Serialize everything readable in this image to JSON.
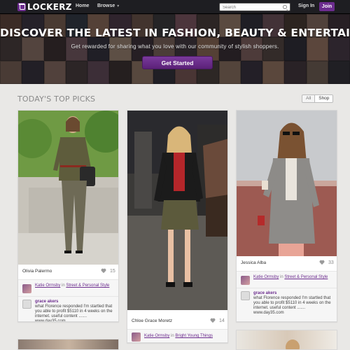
{
  "nav": {
    "logo": "LOCKERZ",
    "home": "Home",
    "browse": "Browse",
    "search_placeholder": "Search",
    "sign_in": "Sign In",
    "join": "Join"
  },
  "hero": {
    "title": "DISCOVER THE LATEST IN FASHION, BEAUTY & ENTERTAINMENT",
    "subtitle": "Get rewarded for sharing what you love with our community of stylish shoppers.",
    "cta": "Get Started"
  },
  "section": {
    "title": "TODAY'S TOP PICKS",
    "filter_all": "All",
    "filter_shop": "Shop"
  },
  "pins": [
    {
      "name": "Olivia Palermo",
      "likes": "15",
      "user": "Katie Ormsby",
      "in_word": "in",
      "board": "Street & Personal Style",
      "commenter": "grace akers",
      "comment": "what Florence responded I'm startled that you able to profit $5110 in 4 weeks on the internet. useful content ....... www.day35.com"
    },
    {
      "name": "Chloe Grace Moretz",
      "likes": "14",
      "user": "Katie Ormsby",
      "in_word": "in",
      "board": "Bright Young Things"
    },
    {
      "name": "Jessica Alba",
      "likes": "33",
      "user": "Katie Ormsby",
      "in_word": "in",
      "board": "Street & Personal Style",
      "commenter": "grace akers",
      "comment": "what Florence responded I'm startled that you able to profit $5110 in 4 weeks on the internet. useful content ....... www.day35.com"
    }
  ],
  "colors": {
    "brand": "#6c2c8e",
    "topbar": "#1e1e22",
    "page_bg": "#e9e8e6"
  },
  "icons": [
    "search-icon",
    "heart-icon",
    "lockerz-logo-icon",
    "chevron-down-icon"
  ]
}
